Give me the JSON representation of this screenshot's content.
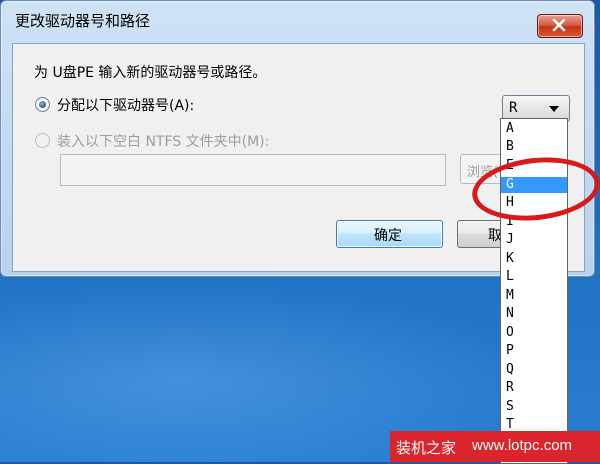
{
  "dialog": {
    "title": "更改驱动器号和路径",
    "prompt": "为 U盘PE 输入新的驱动器号或路径。",
    "option_assign_label": "分配以下驱动器号(A):",
    "option_mount_label": "装入以下空白 NTFS 文件夹中(M):",
    "path_value": "",
    "browse_label": "浏览(",
    "drive_select": {
      "selected": "R"
    },
    "ok_label": "确定",
    "cancel_label": "取"
  },
  "dropdown": {
    "items": [
      "A",
      "B",
      "E",
      "G",
      "H",
      "I",
      "J",
      "K",
      "L",
      "M",
      "N",
      "O",
      "P",
      "Q",
      "R",
      "S",
      "T"
    ],
    "selected_index": 3
  },
  "watermark": {
    "site_name": "装机之家",
    "url": "www.lotpc.com"
  },
  "colors": {
    "selection": "#3399ff",
    "ring": "#d9191b",
    "watermark_bg": "#d9252b"
  }
}
